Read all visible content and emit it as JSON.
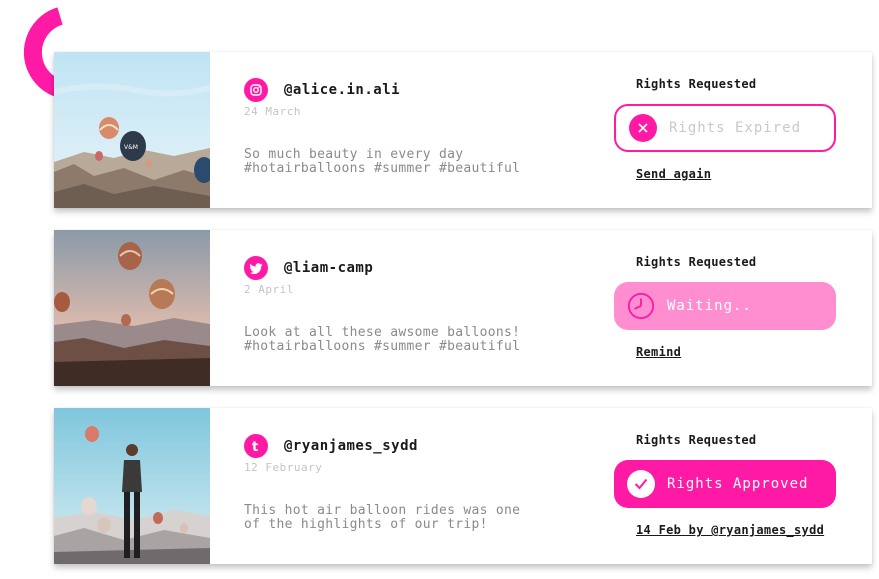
{
  "colors": {
    "accent": "#ff1aa6",
    "accent_light": "#ff8ed0",
    "text_dark": "#1a1a1a",
    "text_muted": "#8a8a8a",
    "text_date": "#c4c4c4"
  },
  "posts": [
    {
      "network_icon": "instagram-icon",
      "handle": "@alice.in.ali",
      "date": "24 March",
      "caption": "So much beauty in every day\n#hotairballoons #summer #beautiful",
      "rights_label": "Rights Requested",
      "status": "Rights Expired",
      "status_icon": "close-icon",
      "action": "Send again"
    },
    {
      "network_icon": "twitter-icon",
      "handle": "@liam-camp",
      "date": "2 April",
      "caption": "Look at all these awsome balloons!\n#hotairballoons #summer #beautiful",
      "rights_label": "Rights Requested",
      "status": "Waiting..",
      "status_icon": "clock-icon",
      "action": "Remind"
    },
    {
      "network_icon": "tumblr-icon",
      "handle": "@ryanjames_sydd",
      "date": "12 February",
      "caption": "This hot air balloon rides was one\nof the highlights of our trip!",
      "rights_label": "Rights Requested",
      "status": "Rights Approved",
      "status_icon": "check-icon",
      "action": "14 Feb by @ryanjames_sydd"
    }
  ]
}
